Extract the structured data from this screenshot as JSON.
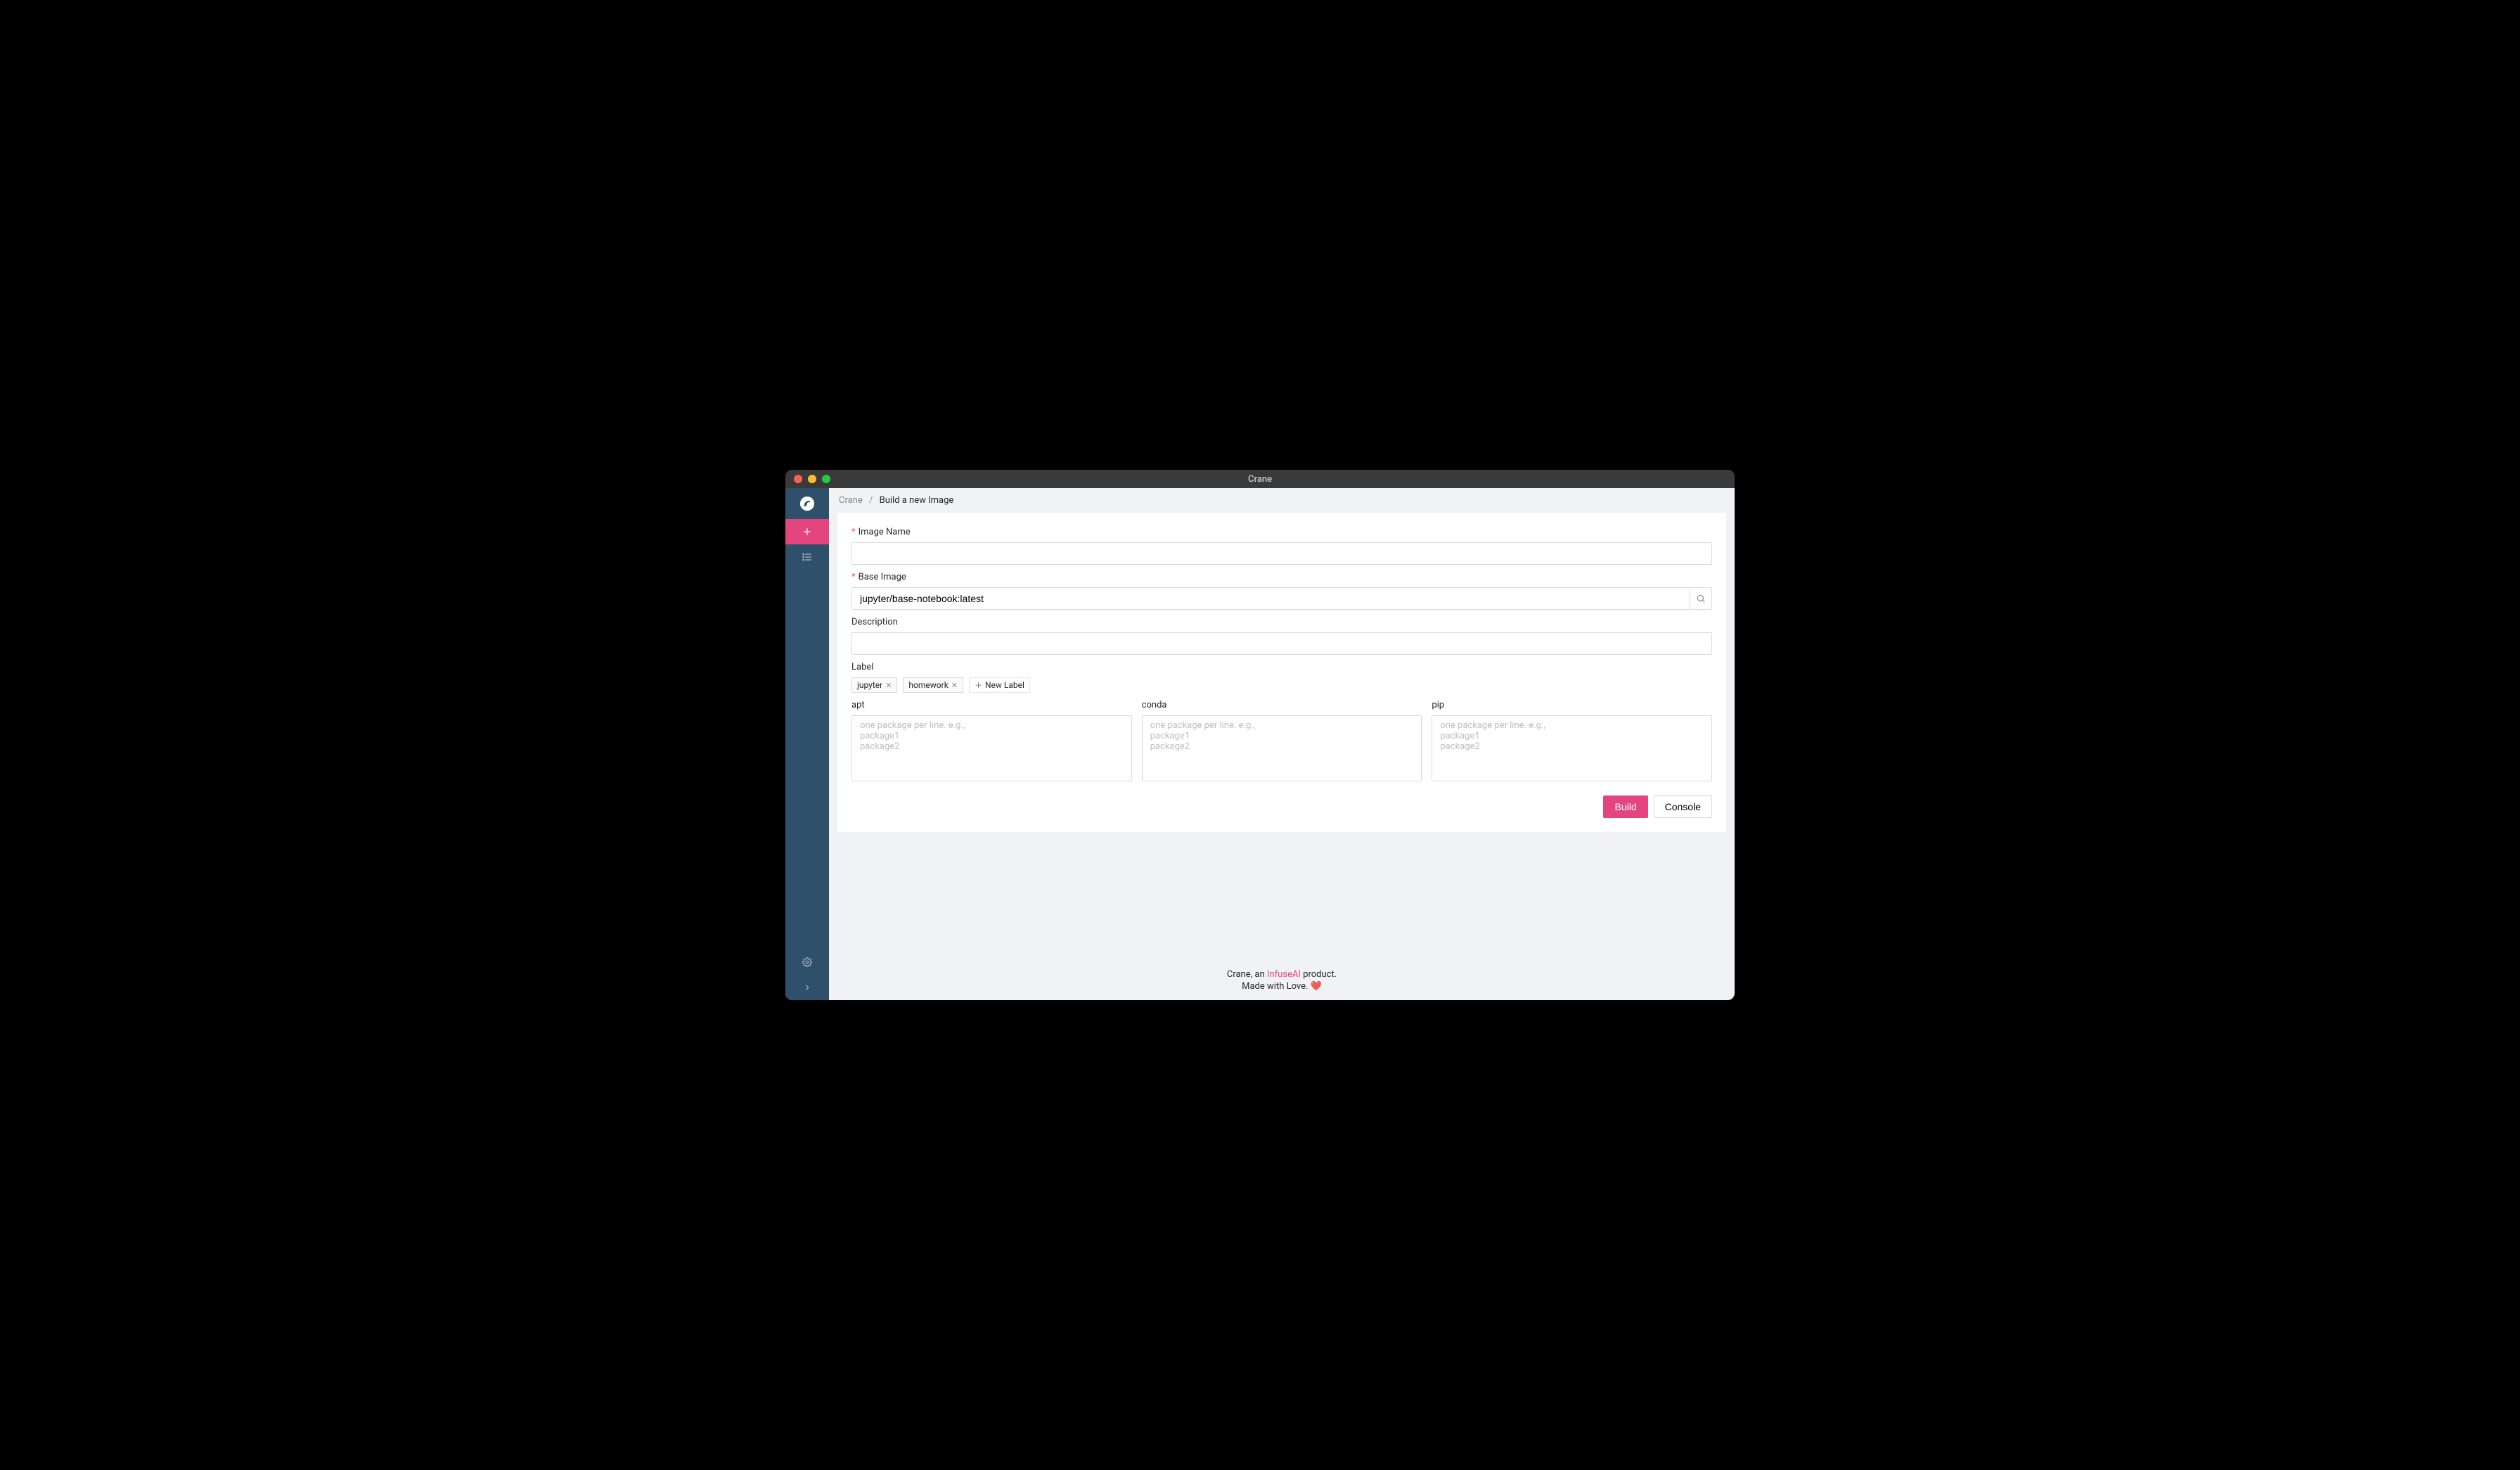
{
  "window": {
    "title": "Crane"
  },
  "breadcrumb": {
    "root": "Crane",
    "current": "Build a new Image"
  },
  "form": {
    "image_name": {
      "label": "Image Name",
      "value": ""
    },
    "base_image": {
      "label": "Base Image",
      "value": "jupyter/base-notebook:latest"
    },
    "description": {
      "label": "Description",
      "value": ""
    },
    "label": {
      "label": "Label",
      "tags": [
        "jupyter",
        "homework"
      ],
      "new_label": "New Label"
    },
    "packages": {
      "apt": {
        "label": "apt",
        "placeholder": "one package per line. e.g.,\npackage1\npackage2"
      },
      "conda": {
        "label": "conda",
        "placeholder": "one package per line. e.g.,\npackage1\npackage2"
      },
      "pip": {
        "label": "pip",
        "placeholder": "one package per line. e.g.,\npackage1\npackage2"
      }
    }
  },
  "actions": {
    "build": "Build",
    "console": "Console"
  },
  "footer": {
    "prefix": "Crane, an ",
    "link": "InfuseAI",
    "suffix": " product.",
    "line2_prefix": "Made with Love. ",
    "heart": "❤️"
  }
}
